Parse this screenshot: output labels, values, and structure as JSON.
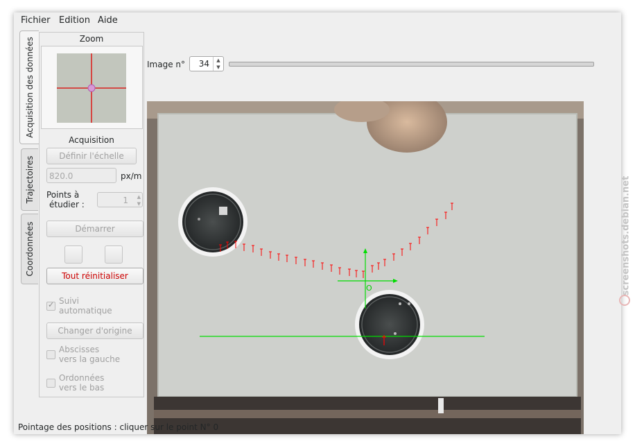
{
  "menu": {
    "fichier": "Fichier",
    "edition": "Edition",
    "aide": "Aide"
  },
  "tabs": {
    "acquisition": "Acquisition des données",
    "trajectoires": "Trajectoires",
    "coordonnees": "Coordonnées"
  },
  "zoom": {
    "title": "Zoom"
  },
  "acquisition": {
    "title": "Acquisition",
    "define_scale_button": "Définir l'échelle",
    "scale_value": "820.0",
    "scale_unit": "px/m",
    "points_label_line1": "Points à",
    "points_label_line2": "étudier :",
    "points_value": "1",
    "start_button": "Démarrer",
    "reset_button": "Tout réinitialiser",
    "auto_follow_line1": "Suivi",
    "auto_follow_line2": "automatique",
    "change_origin_button": "Changer d'origine",
    "abscissa_line1": "Abscisses",
    "abscissa_line2": "vers la gauche",
    "ordinate_line1": "Ordonnées",
    "ordinate_line2": "vers le bas"
  },
  "image": {
    "label": "Image n°",
    "number": "34",
    "origin_label": "O"
  },
  "status": {
    "text": "Pointage des positions : cliquer sur le point N° 0"
  },
  "watermark": {
    "text": "screenshots.debian.net"
  },
  "colors": {
    "marker": "#ff0000",
    "axes": "#00dd00",
    "reset_text": "#cc0000"
  }
}
